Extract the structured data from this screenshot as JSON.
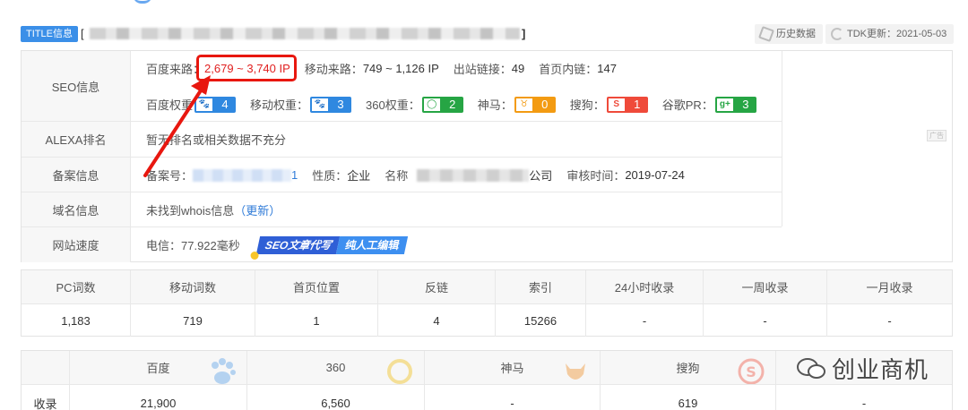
{
  "header": {
    "title_tag": "TITLE信息",
    "title_prefix": "[",
    "title_suffix": "]",
    "history_label": "历史数据",
    "tdk_label": "TDK更新：2021-05-03"
  },
  "seo": {
    "label": "SEO信息",
    "baidu_traffic_label": "百度来路：",
    "baidu_traffic_value": "2,679 ~ 3,740 IP",
    "mobile_traffic_label": "移动来路：",
    "mobile_traffic_value": "749 ~ 1,126 IP",
    "outlinks_label": "出站链接：",
    "outlinks_value": "49",
    "home_inlinks_label": "首页内链：",
    "home_inlinks_value": "147",
    "weights": [
      {
        "label": "百度权重",
        "value": "4",
        "icon": "baidu-paw-icon",
        "color": "#2f88e0"
      },
      {
        "label": "移动权重：",
        "value": "3",
        "icon": "baidu-paw-icon",
        "color": "#2f88e0"
      },
      {
        "label": "360权重：",
        "value": "2",
        "icon": "360-ring-icon",
        "color": "#26a544"
      },
      {
        "label": "神马：",
        "value": "0",
        "icon": "shenma-icon",
        "color": "#f39b12"
      },
      {
        "label": "搜狗：",
        "value": "1",
        "icon": "sogou-icon",
        "color": "#ef4a3a"
      },
      {
        "label": "谷歌PR：",
        "value": "3",
        "icon": "google-plus-icon",
        "color": "#26a544"
      }
    ]
  },
  "alexa": {
    "label": "ALEXA排名",
    "value": "暂无排名或相关数据不充分"
  },
  "icp": {
    "label": "备案信息",
    "number_label": "备案号：",
    "number_suffix": "1",
    "nature_label": "性质：",
    "nature_value": "企业",
    "name_label": "名称",
    "name_suffix": "公司",
    "review_label": "审核时间：",
    "review_value": "2019-07-24"
  },
  "domain": {
    "label": "域名信息",
    "value": "未找到whois信息",
    "update_link": "（更新）"
  },
  "speed": {
    "label": "网站速度",
    "value": "电信：77.922毫秒",
    "banner_1": "SEO文章代写",
    "banner_2": "纯人工编辑"
  },
  "ad_mark": "广告",
  "stats": {
    "headers": [
      "PC词数",
      "移动词数",
      "首页位置",
      "反链",
      "索引",
      "24小时收录",
      "一周收录",
      "一月收录"
    ],
    "values": [
      "1,183",
      "719",
      "1",
      "4",
      "15266",
      "-",
      "-",
      "-"
    ]
  },
  "engines": {
    "headers": [
      "",
      "百度",
      "360",
      "神马",
      "搜狗",
      ""
    ],
    "row_label": "收录",
    "values": [
      "21,900",
      "6,560",
      "-",
      "619",
      "-"
    ]
  },
  "watermark": "创业商机"
}
